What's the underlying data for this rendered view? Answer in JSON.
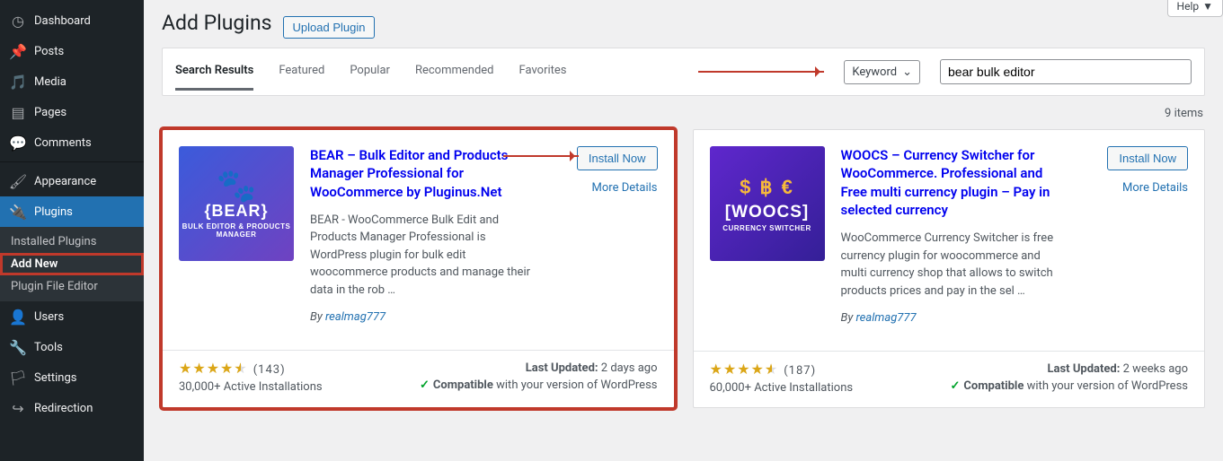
{
  "header": {
    "title": "Add Plugins",
    "upload_btn": "Upload Plugin",
    "help": "Help"
  },
  "sidebar": {
    "items": [
      {
        "label": "Dashboard",
        "icon": "dashboard"
      },
      {
        "label": "Posts",
        "icon": "pin"
      },
      {
        "label": "Media",
        "icon": "media"
      },
      {
        "label": "Pages",
        "icon": "pages"
      },
      {
        "label": "Comments",
        "icon": "comments"
      },
      {
        "label": "Appearance",
        "icon": "appearance"
      },
      {
        "label": "Plugins",
        "icon": "plugins",
        "active": true
      },
      {
        "label": "Users",
        "icon": "users"
      },
      {
        "label": "Tools",
        "icon": "tools"
      },
      {
        "label": "Settings",
        "icon": "settings"
      },
      {
        "label": "Redirection",
        "icon": "redirection"
      }
    ],
    "sub": [
      "Installed Plugins",
      "Add New",
      "Plugin File Editor"
    ]
  },
  "filter": {
    "tabs": [
      "Search Results",
      "Featured",
      "Popular",
      "Recommended",
      "Favorites"
    ],
    "keyword_label": "Keyword",
    "search_value": "bear bulk editor",
    "items_count": "9 items"
  },
  "plugins": [
    {
      "thumb": {
        "kind": "bear",
        "brand": "{BEAR}",
        "sub": "BULK EDITOR & PRODUCTS MANAGER",
        "top": "🐾"
      },
      "title": "BEAR – Bulk Editor and Products Manager Professional for WooCommerce by Pluginus.Net",
      "desc": "BEAR - WooCommerce Bulk Edit and Products Manager Professional is WordPress plugin for bulk edit woocommerce products and manage their data in the rob …",
      "by_prefix": "By ",
      "author": "realmag777",
      "install": "Install Now",
      "more": "More Details",
      "rating_count": "(143)",
      "active": "30,000+ Active Installations",
      "updated_label": "Last Updated:",
      "updated_val": "2 days ago",
      "compat_label": "Compatible",
      "compat_rest": " with your version of WordPress",
      "highlighted": true,
      "show_arrow": true
    },
    {
      "thumb": {
        "kind": "woocs",
        "brand": "[WOOCS]",
        "sub": "CURRENCY SWITCHER",
        "top": "$ ฿ €"
      },
      "title": "WOOCS – Currency Switcher for WooCommerce. Professional and Free multi currency plugin – Pay in selected currency",
      "desc": "WooCommerce Currency Switcher is free currency plugin for woocommerce and multi currency shop that allows to switch products prices and pay in the sel …",
      "by_prefix": "By ",
      "author": "realmag777",
      "install": "Install Now",
      "more": "More Details",
      "rating_count": "(187)",
      "active": "60,000+ Active Installations",
      "updated_label": "Last Updated:",
      "updated_val": "2 weeks ago",
      "compat_label": "Compatible",
      "compat_rest": " with your version of WordPress",
      "highlighted": false,
      "show_arrow": false
    }
  ]
}
